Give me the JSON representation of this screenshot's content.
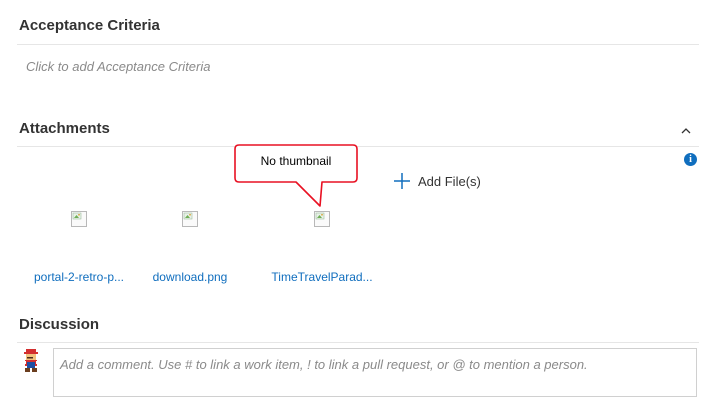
{
  "acceptance_criteria": {
    "title": "Acceptance Criteria",
    "placeholder": "Click to add Acceptance Criteria"
  },
  "attachments": {
    "title": "Attachments",
    "add_files_label": "Add File(s)",
    "files": [
      {
        "name": "portal-2-retro-p..."
      },
      {
        "name": "download.png"
      },
      {
        "name": "TimeTravelParad..."
      }
    ],
    "callout_text": "No thumbnail",
    "info_icon": "info-icon",
    "collapse_icon": "chevron-up-icon"
  },
  "discussion": {
    "title": "Discussion",
    "comment_placeholder": "Add a comment. Use # to link a work item, ! to link a pull request, or @ to mention a person."
  },
  "colors": {
    "link": "#106ebe",
    "callout_border": "#e81123",
    "placeholder": "#8a8a8a",
    "divider": "#e6e6e6"
  }
}
